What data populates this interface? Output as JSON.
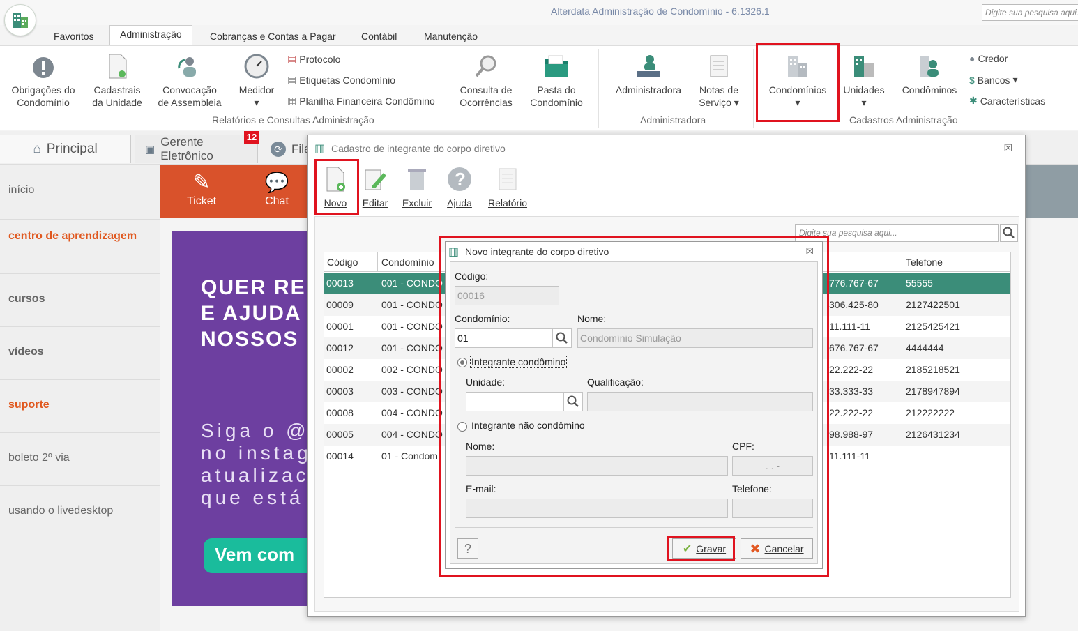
{
  "window": {
    "title": "Alterdata Administração de Condomínio - 6.1326.1",
    "search_placeholder": "Digite sua pesquisa aqui..."
  },
  "menu_tabs": [
    "Favoritos",
    "Administração",
    "Cobranças e Contas a Pagar",
    "Contábil",
    "Manutenção"
  ],
  "ribbon": {
    "obrigacoes": [
      "Obrigações do",
      "Condomínio"
    ],
    "cadastrais": [
      "Cadastrais",
      "da Unidade"
    ],
    "convocacao": [
      "Convocação",
      "de Assembleia"
    ],
    "medidor": "Medidor",
    "protocolo": "Protocolo",
    "etiquetas": "Etiquetas Condomínio",
    "planilha": "Planilha Financeira Condômino",
    "consulta": [
      "Consulta de",
      "Ocorrências"
    ],
    "pasta": [
      "Pasta do",
      "Condomínio"
    ],
    "group_relatorios": "Relatórios e Consultas Administração",
    "administradora": "Administradora",
    "notas": [
      "Notas de",
      "Serviço"
    ],
    "group_administradora": "Administradora",
    "condominios": "Condomínios",
    "unidades": "Unidades",
    "condominos": "Condôminos",
    "credor": "Credor",
    "bancos": "Bancos",
    "caracteristicas": "Características",
    "group_cadastros": "Cadastros Administração"
  },
  "page_tabs": {
    "principal": "Principal",
    "gerente": "Gerente Eletrônico",
    "gerente_badge": "12",
    "fila": "Fila"
  },
  "left_nav": [
    "início",
    "centro de aprendizagem",
    "cursos",
    "vídeos",
    "suporte",
    "boleto 2º via",
    "usando o livedesktop"
  ],
  "orange_bar": {
    "ticket": "Ticket",
    "chat": "Chat"
  },
  "banner": {
    "headline": [
      "QUER RE",
      "E AJUDA",
      "NOSSOS"
    ],
    "body": [
      "Siga o @",
      "no instag",
      "atualizac",
      "que está"
    ],
    "cta": "Vem com"
  },
  "dialog_main": {
    "title": "Cadastro de integrante do corpo diretivo",
    "close": "☒",
    "toolbar": {
      "novo": "Novo",
      "editar": "Editar",
      "excluir": "Excluir",
      "ajuda": "Ajuda",
      "relatorio": "Relatório"
    },
    "search_placeholder": "Digite sua pesquisa aqui...",
    "columns": {
      "codigo": "Código",
      "condominio": "Condomínio",
      "telefone": "Telefone"
    },
    "rows": [
      {
        "codigo": "00013",
        "cond": "001 - CONDO",
        "doc": "776.767-67",
        "tel": "55555"
      },
      {
        "codigo": "00009",
        "cond": "001 - CONDO",
        "doc": "306.425-80",
        "tel": "2127422501"
      },
      {
        "codigo": "00001",
        "cond": "001 - CONDO",
        "doc": "11.111-11",
        "tel": "2125425421"
      },
      {
        "codigo": "00012",
        "cond": "001 - CONDO",
        "doc": "676.767-67",
        "tel": "4444444"
      },
      {
        "codigo": "00002",
        "cond": "002 - CONDO",
        "doc": "22.222-22",
        "tel": "2185218521"
      },
      {
        "codigo": "00003",
        "cond": "003 - CONDO",
        "doc": "33.333-33",
        "tel": "2178947894"
      },
      {
        "codigo": "00008",
        "cond": "004 - CONDO",
        "doc": "22.222-22",
        "tel": "212222222"
      },
      {
        "codigo": "00005",
        "cond": "004 - CONDO",
        "doc": "98.988-97",
        "tel": "2126431234"
      },
      {
        "codigo": "00014",
        "cond": "01 - Condom",
        "doc": "11.111-11",
        "tel": ""
      }
    ]
  },
  "dialog_new": {
    "title": "Novo integrante do corpo diretivo",
    "close": "☒",
    "codigo_label": "Código:",
    "codigo_value": "00016",
    "condominio_label": "Condomínio:",
    "condominio_value": "01",
    "nome_label": "Nome:",
    "nome_value": "Condomínio Simulação",
    "radio_condomino": "Integrante condômino",
    "unidade_label": "Unidade:",
    "qualificacao_label": "Qualificação:",
    "radio_nao_condomino": "Integrante não condômino",
    "nome2_label": "Nome:",
    "cpf_label": "CPF:",
    "cpf_value": ".   .   -",
    "email_label": "E-mail:",
    "telefone_label": "Telefone:",
    "help": "?",
    "gravar": "Gravar",
    "cancelar": "Cancelar"
  },
  "colors": {
    "accent_red": "#e0131f",
    "orange": "#d9522b",
    "selected_row": "#3b8d79",
    "purple": "#6d3fa0"
  }
}
